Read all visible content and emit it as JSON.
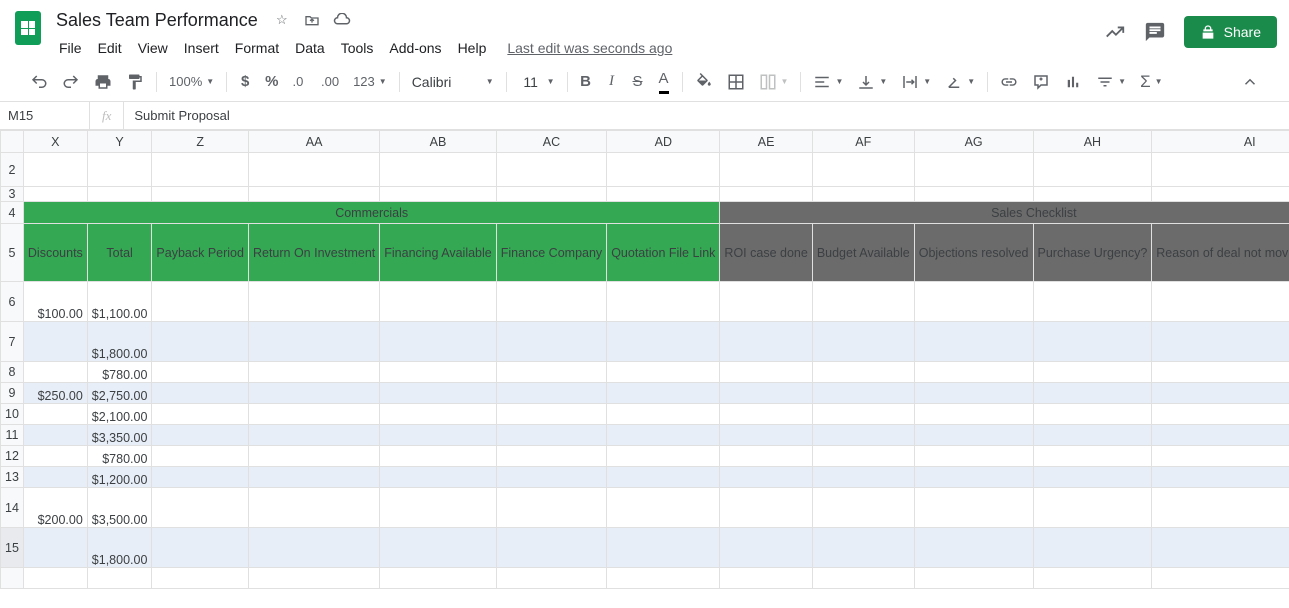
{
  "doc": {
    "title": "Sales Team Performance",
    "last_edit": "Last edit was seconds ago"
  },
  "menus": [
    "File",
    "Edit",
    "View",
    "Insert",
    "Format",
    "Data",
    "Tools",
    "Add-ons",
    "Help"
  ],
  "share_label": "Share",
  "toolbar": {
    "zoom": "100%",
    "font": "Calibri",
    "size": "11",
    "more_fmt": "123"
  },
  "namebox": "M15",
  "formula": "Submit Proposal",
  "columns": [
    "X",
    "Y",
    "Z",
    "AA",
    "AB",
    "AC",
    "AD",
    "AE",
    "AF",
    "AG",
    "AH",
    "AI"
  ],
  "row_nums": [
    "2",
    "3",
    "4",
    "5",
    "6",
    "7",
    "8",
    "9",
    "10",
    "11",
    "12",
    "13",
    "14",
    "15"
  ],
  "section_headers": {
    "commercials": "Commercials",
    "checklist": "Sales Checklist"
  },
  "sub_headers": {
    "x": "Discounts",
    "y": "Total",
    "z": "Payback Period",
    "aa": "Return On Investment",
    "ab": "Financing Available",
    "ac": "Finance Company",
    "ad": "Quotation File Link",
    "ae": "ROI case done",
    "af": "Budget Available",
    "ag": "Objections resolved",
    "ah": "Purchase Urgency?",
    "ai": "Reason of deal not moving ahead"
  },
  "rows": [
    {
      "x": "$100.00",
      "y": "$1,100.00"
    },
    {
      "x": "",
      "y": "$1,800.00"
    },
    {
      "x": "",
      "y": "$780.00"
    },
    {
      "x": "$250.00",
      "y": "$2,750.00"
    },
    {
      "x": "",
      "y": "$2,100.00"
    },
    {
      "x": "",
      "y": "$3,350.00"
    },
    {
      "x": "",
      "y": "$780.00"
    },
    {
      "x": "",
      "y": "$1,200.00"
    },
    {
      "x": "$200.00",
      "y": "$3,500.00"
    },
    {
      "x": "",
      "y": "$1,800.00"
    }
  ]
}
